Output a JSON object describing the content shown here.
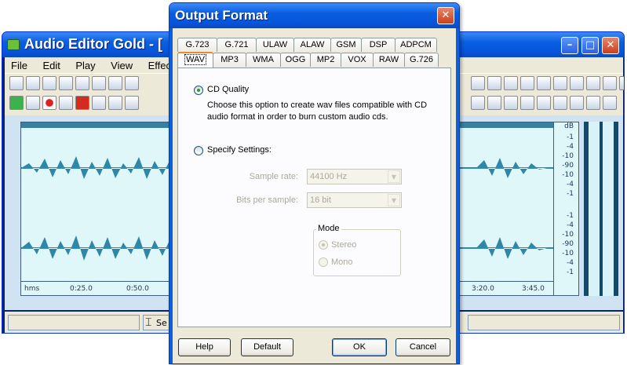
{
  "main_window": {
    "title": "Audio Editor Gold - [",
    "menu": [
      "File",
      "Edit",
      "Play",
      "View",
      "Effect"
    ],
    "timeline_labels": [
      "hms",
      "0:25.0",
      "0:50.0",
      "3:20.0",
      "3:45.0"
    ],
    "db_labels": [
      "dB",
      "-1",
      "-4",
      "-10",
      "-90",
      "-10",
      "-4",
      "-1",
      "-1",
      "-4",
      "-10",
      "-90",
      "-10",
      "-4",
      "-1"
    ],
    "status_text": "Se",
    "window_buttons": {
      "minimize": "–",
      "maximize": "□",
      "close": "✕"
    }
  },
  "dialog": {
    "title": "Output Format",
    "close_glyph": "✕",
    "tabs_row1": [
      "G.723",
      "G.721",
      "ULAW",
      "ALAW",
      "GSM",
      "DSP",
      "ADPCM"
    ],
    "tabs_row2": [
      "WAV",
      "MP3",
      "WMA",
      "OGG",
      "MP2",
      "VOX",
      "RAW",
      "G.726"
    ],
    "active_tab": "WAV",
    "cd_quality": {
      "label": "CD Quality",
      "checked": true,
      "description": "Choose this option to create wav files compatible with CD audio format in order to burn custom audio cds."
    },
    "specify": {
      "label": "Specify Settings:",
      "checked": false,
      "sample_rate_label": "Sample rate:",
      "sample_rate_value": "44100 Hz",
      "bits_label": "Bits per sample:",
      "bits_value": "16 bit"
    },
    "mode": {
      "label": "Mode",
      "options": [
        "Stereo",
        "Mono"
      ],
      "selected": "Stereo"
    },
    "buttons": {
      "help": "Help",
      "default": "Default",
      "ok": "OK",
      "cancel": "Cancel"
    }
  }
}
